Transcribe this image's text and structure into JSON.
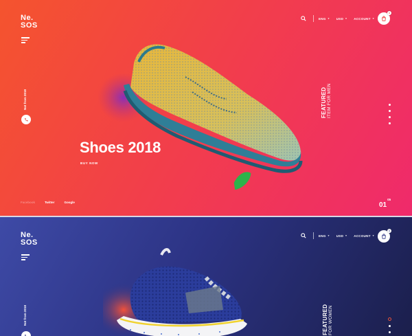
{
  "brand": {
    "line1": "Ne.",
    "line2": "SOS"
  },
  "nav": {
    "currency": "ENG",
    "language": "USD",
    "account": "ACCOUNT",
    "cart_count": "1"
  },
  "slides": [
    {
      "vertical_text": "Not from 2018",
      "headline": "Shoes 2018",
      "cta": "BUY NOW",
      "featured_line1": "FEATURED",
      "featured_line2": "ITEM FOR MEN",
      "social": [
        "Facebook",
        "Twitter",
        "Google"
      ],
      "page_current": "01",
      "page_total": "05",
      "colors": {
        "bg_start": "#f4542e",
        "bg_end": "#ef2a6b"
      }
    },
    {
      "vertical_text": "Not from 2018",
      "featured_line1": "FEATURED",
      "featured_line2": "FOR WOMEN",
      "colors": {
        "bg_start": "#3e4aa6",
        "bg_end": "#1b1f4c"
      }
    }
  ],
  "icons": [
    "search-icon",
    "chevron-down-icon",
    "bag-icon",
    "phone-icon",
    "hamburger-icon"
  ]
}
